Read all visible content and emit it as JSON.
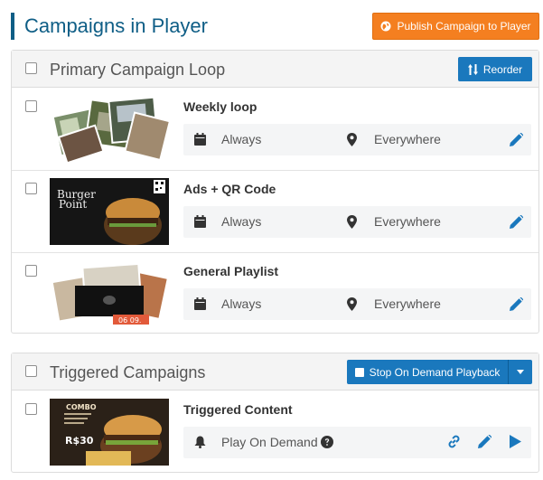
{
  "header": {
    "title": "Campaigns in Player",
    "publish_label": "Publish Campaign to Player"
  },
  "primary": {
    "title": "Primary Campaign Loop",
    "reorder_label": "Reorder",
    "rows": [
      {
        "name": "Weekly loop",
        "schedule": "Always",
        "location": "Everywhere"
      },
      {
        "name": "Ads + QR Code",
        "schedule": "Always",
        "location": "Everywhere"
      },
      {
        "name": "General Playlist",
        "schedule": "Always",
        "location": "Everywhere"
      }
    ],
    "thumb_texts": {
      "burger_brand_line1": "Burger",
      "burger_brand_line2": "Point",
      "date_tag": "06 09."
    }
  },
  "triggered": {
    "title": "Triggered Campaigns",
    "stop_label": "Stop On Demand Playback",
    "rows": [
      {
        "name": "Triggered Content",
        "trigger": "Play On Demand"
      }
    ],
    "thumb_texts": {
      "combo": "COMBO",
      "price": "R$30"
    }
  },
  "colors": {
    "title_blue": "#0f5e86",
    "button_blue": "#1a78bd",
    "publish_orange": "#f47f20",
    "icon_blue": "#1a78bd"
  }
}
